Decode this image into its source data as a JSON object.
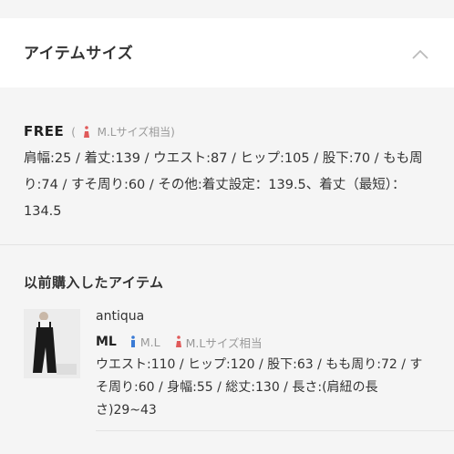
{
  "header": {
    "title": "アイテムサイズ"
  },
  "size": {
    "name": "FREE",
    "paren_open": "(",
    "fit_note": "M.Lサイズ相当)",
    "details": "肩幅:25 / 着丈:139 / ウエスト:87 / ヒップ:105 / 股下:70 / もも周り:74 / すそ周り:60 / その他:着丈設定：139.5、着丈（最短）：134.5"
  },
  "previous": {
    "title": "以前購入したアイテム",
    "item": {
      "brand": "antiqua",
      "size": "ML",
      "men_fit": "M.L",
      "women_fit": "M.Lサイズ相当",
      "details": "ウエスト:110 / ヒップ:120 / 股下:63 / もも周り:72 / すそ周り:60 / 身幅:55 / 総丈:130 / 長さ:(肩紐の長さ)29~43"
    }
  },
  "colors": {
    "accent_woman": "#e05a5a",
    "accent_man": "#3a7bd5",
    "muted": "#999999"
  },
  "icons": {
    "collapse": "chevron-up-icon",
    "woman": "woman-icon",
    "man": "man-icon"
  }
}
